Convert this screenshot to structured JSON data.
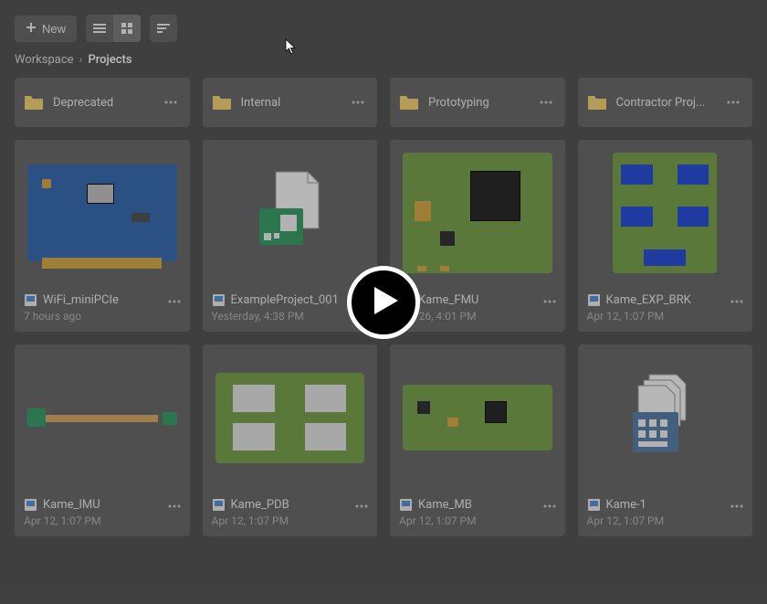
{
  "toolbar": {
    "new_label": "New"
  },
  "breadcrumb": {
    "root": "Workspace",
    "current": "Projects"
  },
  "folders": [
    {
      "name": "Deprecated"
    },
    {
      "name": "Internal"
    },
    {
      "name": "Prototyping"
    },
    {
      "name": "Contractor Proj..."
    }
  ],
  "projects": [
    {
      "name": "WiFi_miniPCIe",
      "date": "7 hours ago",
      "thumb": "wifi"
    },
    {
      "name": "ExampleProject_001",
      "date": "Yesterday, 4:38 PM",
      "thumb": "example"
    },
    {
      "name": "Kame_FMU",
      "date": "Apr 26, 4:01 PM",
      "thumb": "fmu"
    },
    {
      "name": "Kame_EXP_BRK",
      "date": "Apr 12, 1:07 PM",
      "thumb": "expbrk"
    },
    {
      "name": "Kame_IMU",
      "date": "Apr 12, 1:07 PM",
      "thumb": "imu"
    },
    {
      "name": "Kame_PDB",
      "date": "Apr 12, 1:07 PM",
      "thumb": "pdb"
    },
    {
      "name": "Kame_MB",
      "date": "Apr 12, 1:07 PM",
      "thumb": "mb"
    },
    {
      "name": "Kame-1",
      "date": "Apr 12, 1:07 PM",
      "thumb": "kame1"
    }
  ]
}
